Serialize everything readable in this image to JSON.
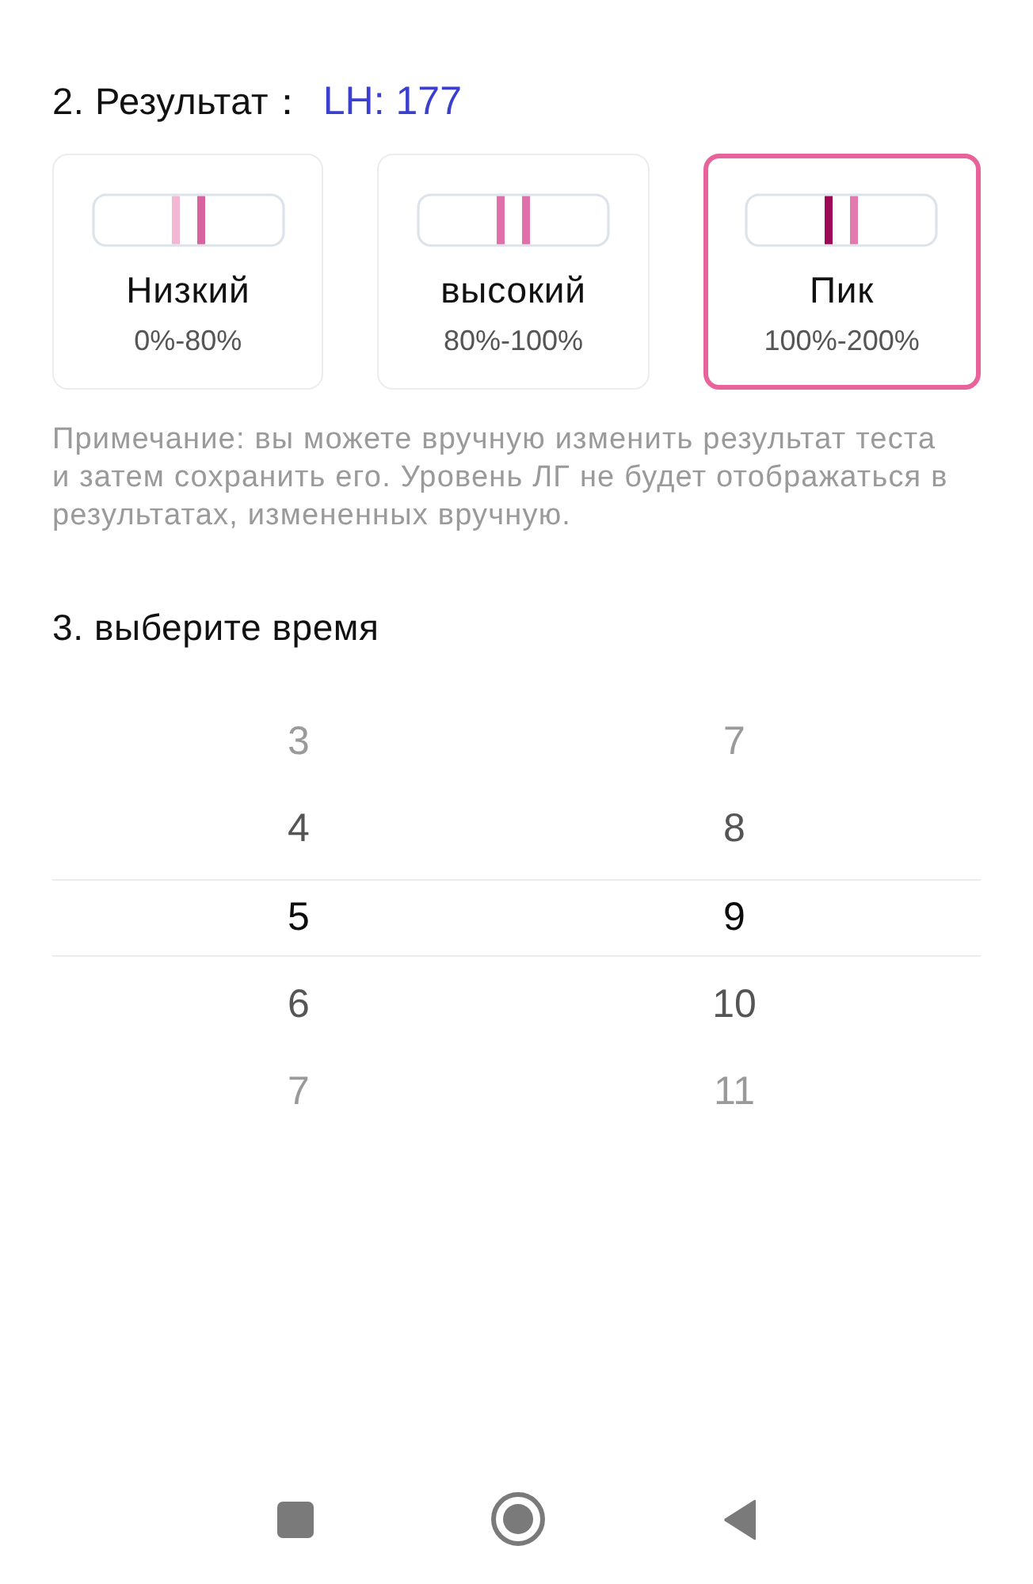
{
  "result": {
    "label": "2. Результат：",
    "value": "LH: 177"
  },
  "levels": [
    {
      "name": "Низкий",
      "range": "0%-80%",
      "selected": false,
      "lines": [
        {
          "color": "#f2b8d3"
        },
        {
          "color": "#d9639f"
        }
      ]
    },
    {
      "name": "высокий",
      "range": "80%-100%",
      "selected": false,
      "lines": [
        {
          "color": "#e070aa"
        },
        {
          "color": "#e070aa"
        }
      ]
    },
    {
      "name": "Пик",
      "range": "100%-200%",
      "selected": true,
      "lines": [
        {
          "color": "#9e0a55"
        },
        {
          "color": "#e27aae"
        }
      ]
    }
  ],
  "note": "Примечание: вы можете вручную изменить результат теста и затем сохранить его. Уровень ЛГ не будет отображаться в результатах, измененных вручную.",
  "time": {
    "title": "3. выберите время",
    "columns": [
      {
        "items": [
          {
            "label": "3",
            "selected": false
          },
          {
            "label": "4",
            "selected": false
          },
          {
            "label": "5",
            "selected": true
          },
          {
            "label": "6",
            "selected": false
          },
          {
            "label": "7",
            "selected": false
          }
        ]
      },
      {
        "items": [
          {
            "label": "7",
            "selected": false
          },
          {
            "label": "8",
            "selected": false
          },
          {
            "label": "9",
            "selected": true
          },
          {
            "label": "10",
            "selected": false
          },
          {
            "label": "11",
            "selected": false
          }
        ]
      }
    ]
  },
  "nav_bar": {
    "buttons": [
      {
        "kind": "recents"
      },
      {
        "kind": "home"
      },
      {
        "kind": "back"
      }
    ]
  }
}
